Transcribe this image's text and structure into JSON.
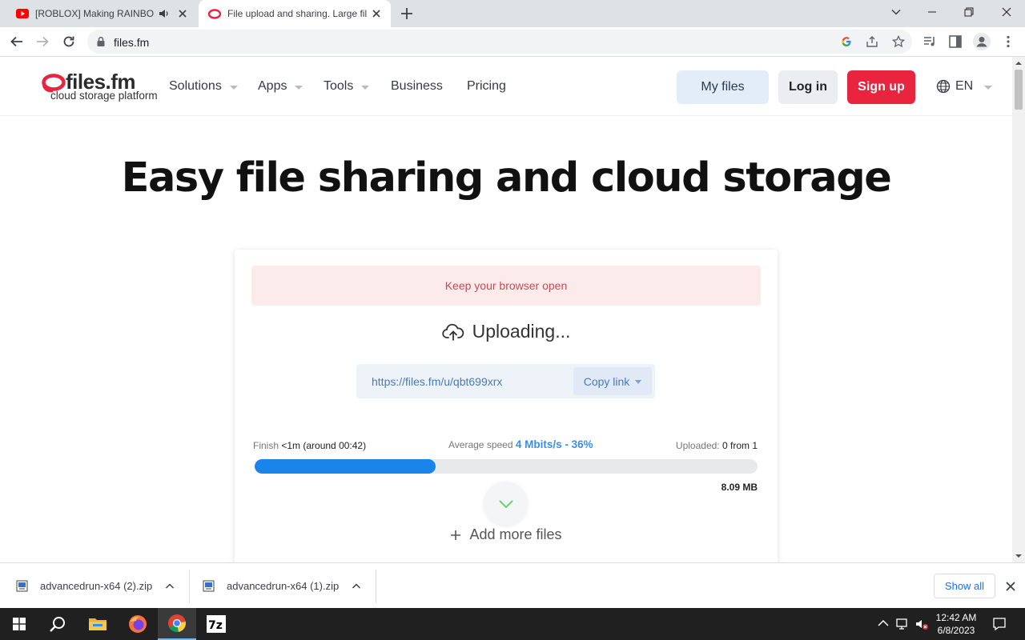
{
  "browser": {
    "tabs": [
      {
        "title": "[ROBLOX] Making RAINBOW",
        "active": false,
        "favicon": "youtube-icon",
        "audio": true
      },
      {
        "title": "File upload and sharing. Large fil",
        "active": true,
        "favicon": "filesfm-icon"
      }
    ],
    "url": "files.fm"
  },
  "site": {
    "logo_brand": "files.fm",
    "logo_tagline": "cloud storage platform",
    "nav": {
      "solutions": "Solutions",
      "apps": "Apps",
      "tools": "Tools",
      "business": "Business",
      "pricing": "Pricing"
    },
    "my_files": "My files",
    "log_in": "Log in",
    "sign_up": "Sign up",
    "language": "EN",
    "hero_title": "Easy file sharing and cloud storage"
  },
  "upload": {
    "warning": "Keep your browser open",
    "status": "Uploading...",
    "share_url": "https://files.fm/u/qbt699xrx",
    "copy_link": "Copy link",
    "finish_label": "Finish",
    "finish_value": "<1m (around 00:42)",
    "speed_label": "Average speed",
    "speed_value": "4 Mbits/s - 36%",
    "uploaded_label": "Uploaded:",
    "uploaded_value": "0 from 1",
    "progress_percent": 36,
    "size": "8.09 MB",
    "add_more": "Add more files"
  },
  "downloads": {
    "items": [
      {
        "name": "advancedrun-x64 (2).zip"
      },
      {
        "name": "advancedrun-x64 (1).zip"
      }
    ],
    "show_all": "Show all"
  },
  "taskbar": {
    "time": "12:42 AM",
    "date": "6/8/2023"
  },
  "colors": {
    "signup": "#e8243f",
    "progress": "#1a84ea",
    "speed": "#3a8ee6",
    "warning_bg": "#fcebeb"
  }
}
